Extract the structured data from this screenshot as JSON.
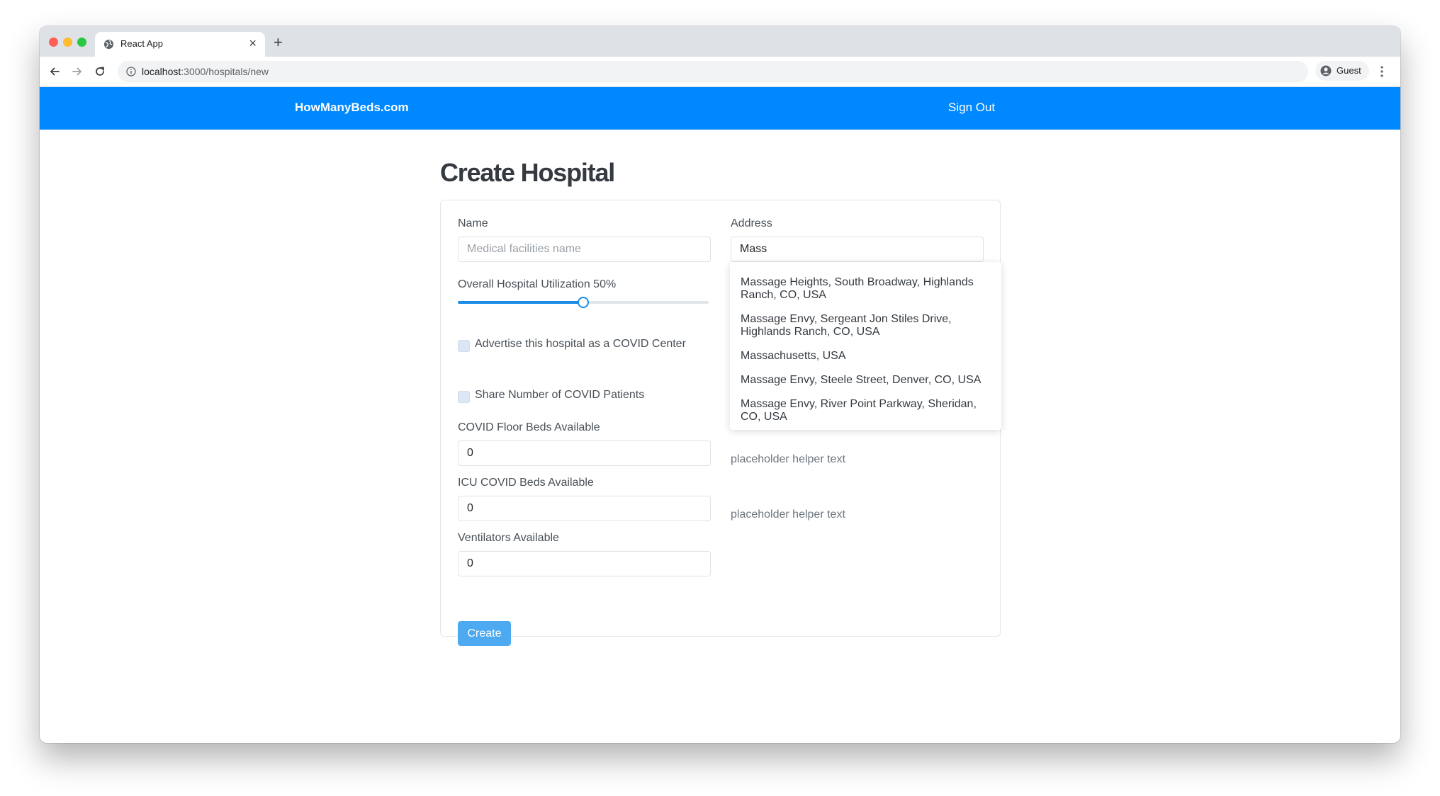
{
  "browser": {
    "tab_title": "React App",
    "tab_close": "×",
    "new_tab": "+",
    "url_host": "localhost",
    "url_path": ":3000/hospitals/new",
    "profile_label": "Guest"
  },
  "navbar": {
    "brand": "HowManyBeds.com",
    "sign_out": "Sign Out",
    "color": "#0088ff"
  },
  "form": {
    "title": "Create Hospital",
    "name": {
      "label": "Name",
      "placeholder": "Medical facilities name",
      "value": ""
    },
    "address": {
      "label": "Address",
      "value": "Mass"
    },
    "utilization": {
      "label": "Overall Hospital Utilization 50%",
      "value_percent": 50
    },
    "advertise_checkbox": {
      "label": "Advertise this hospital as a COVID Center",
      "checked": false
    },
    "share_checkbox": {
      "label": "Share Number of COVID Patients",
      "checked": false
    },
    "covid_floor_beds": {
      "label": "COVID Floor Beds Available",
      "value": "0",
      "helper": "placeholder helper text"
    },
    "icu_covid_beds": {
      "label": "ICU COVID Beds Available",
      "value": "0",
      "helper": "placeholder helper text"
    },
    "ventilators": {
      "label": "Ventilators Available",
      "value": "0"
    },
    "create_label": "Create",
    "accent_color": "#1a8ce8"
  },
  "address_suggestions": [
    "Massage Heights, South Broadway, Highlands Ranch, CO, USA",
    "Massage Envy, Sergeant Jon Stiles Drive, Highlands Ranch, CO, USA",
    "Massachusetts, USA",
    "Massage Envy, Steele Street, Denver, CO, USA",
    "Massage Envy, River Point Parkway, Sheridan, CO, USA"
  ]
}
